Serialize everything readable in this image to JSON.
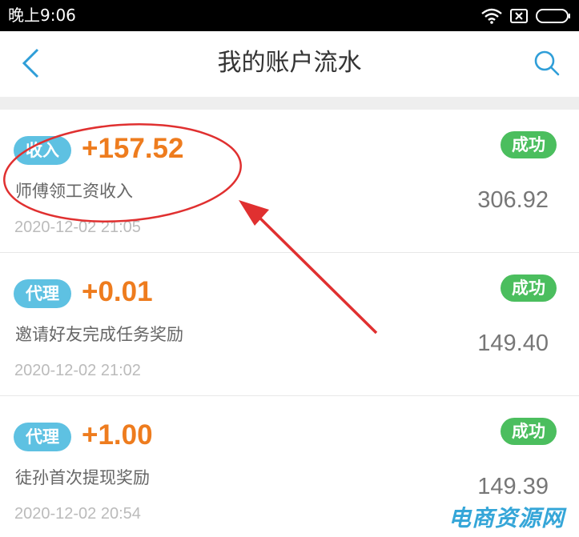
{
  "status_bar": {
    "time": "晚上9:06"
  },
  "nav": {
    "title": "我的账户流水",
    "back_icon": "chevron-left-icon",
    "search_icon": "search-icon"
  },
  "records": [
    {
      "tag": "收入",
      "amount": "+157.52",
      "status": "成功",
      "description": "师傅领工资收入",
      "balance": "306.92",
      "time": "2020-12-02 21:05"
    },
    {
      "tag": "代理",
      "amount": "+0.01",
      "status": "成功",
      "description": "邀请好友完成任务奖励",
      "balance": "149.40",
      "time": "2020-12-02 21:02"
    },
    {
      "tag": "代理",
      "amount": "+1.00",
      "status": "成功",
      "description": "徒孙首次提现奖励",
      "balance": "149.39",
      "time": "2020-12-02 20:54"
    }
  ],
  "watermark": "电商资源网",
  "colors": {
    "accent_blue": "#2f9ed8",
    "tag_blue": "#5ec1e2",
    "amount_orange": "#ee7c1e",
    "success_green": "#4bbe5e",
    "annotation_red": "#e03030"
  }
}
